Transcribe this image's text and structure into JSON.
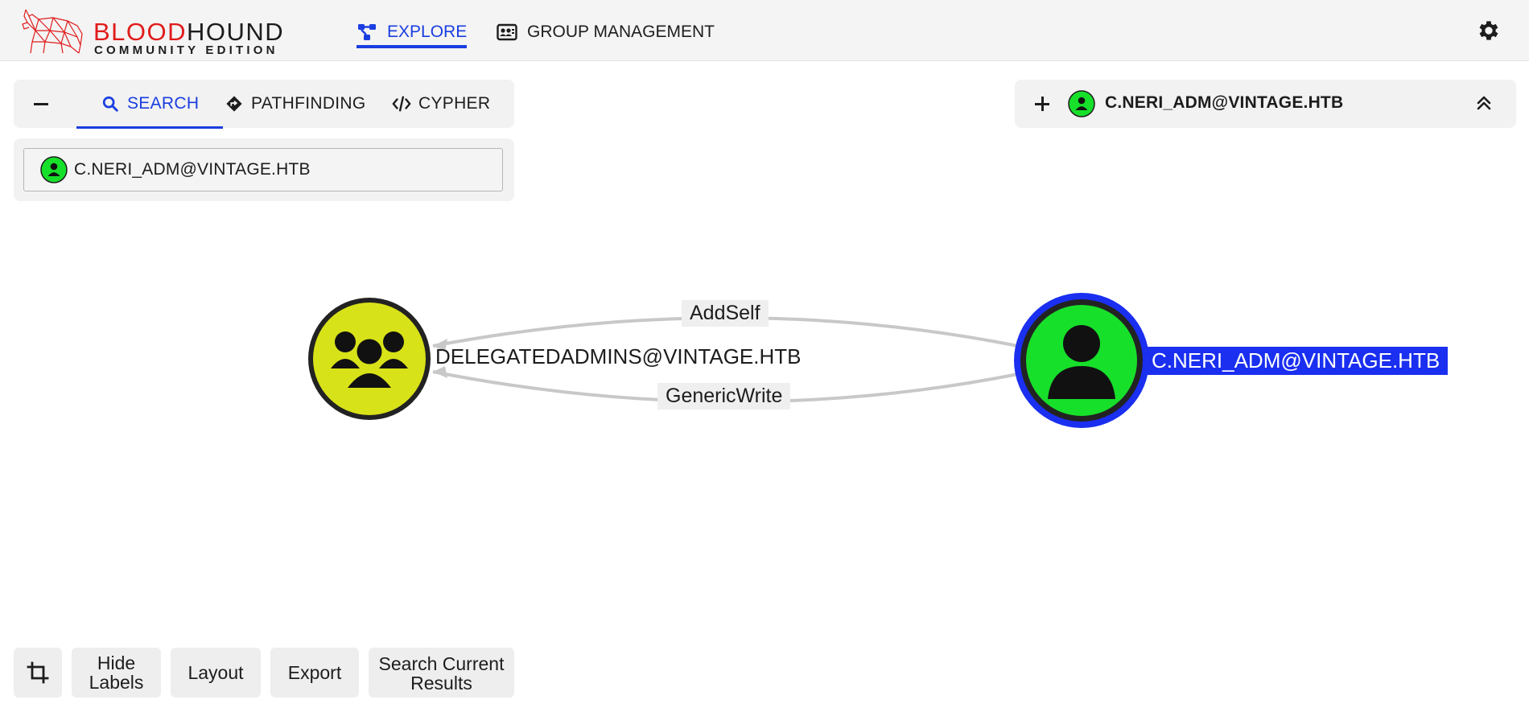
{
  "app": {
    "logo_name_red": "BLOOD",
    "logo_name_dark": "HOUND",
    "logo_subtitle": "COMMUNITY EDITION",
    "brand_color": "#e01b1b",
    "accent_color": "#1a3ee0"
  },
  "nav": {
    "explore_label": "EXPLORE",
    "group_management_label": "GROUP MANAGEMENT",
    "explore_icon": "graph-nodes-icon",
    "group_icon": "id-card-icon",
    "settings_icon": "gear-icon"
  },
  "search_panel": {
    "tabs": [
      {
        "label": "SEARCH",
        "icon": "search-icon",
        "active": true
      },
      {
        "label": "PATHFINDING",
        "icon": "diamond-arrow-icon",
        "active": false
      },
      {
        "label": "CYPHER",
        "icon": "code-icon",
        "active": false
      }
    ],
    "query_value": "C.NERI_ADM@VINTAGE.HTB"
  },
  "node_panel": {
    "selected_node": "C.NERI_ADM@VINTAGE.HTB"
  },
  "graph": {
    "nodes": [
      {
        "label": "DELEGATEDADMINS@VINTAGE.HTB",
        "type": "group",
        "color": "#d8e218"
      },
      {
        "label": "C.NERI_ADM@VINTAGE.HTB",
        "type": "user",
        "color": "#17e02a",
        "selected": true,
        "highlight_color": "#1a2ff0"
      }
    ],
    "edges": [
      {
        "label": "AddSelf"
      },
      {
        "label": "GenericWrite"
      }
    ]
  },
  "controls": {
    "hide_labels": "Hide Labels",
    "layout": "Layout",
    "export": "Export",
    "search_current_results": "Search Current Results",
    "crop_icon": "crop-icon"
  }
}
